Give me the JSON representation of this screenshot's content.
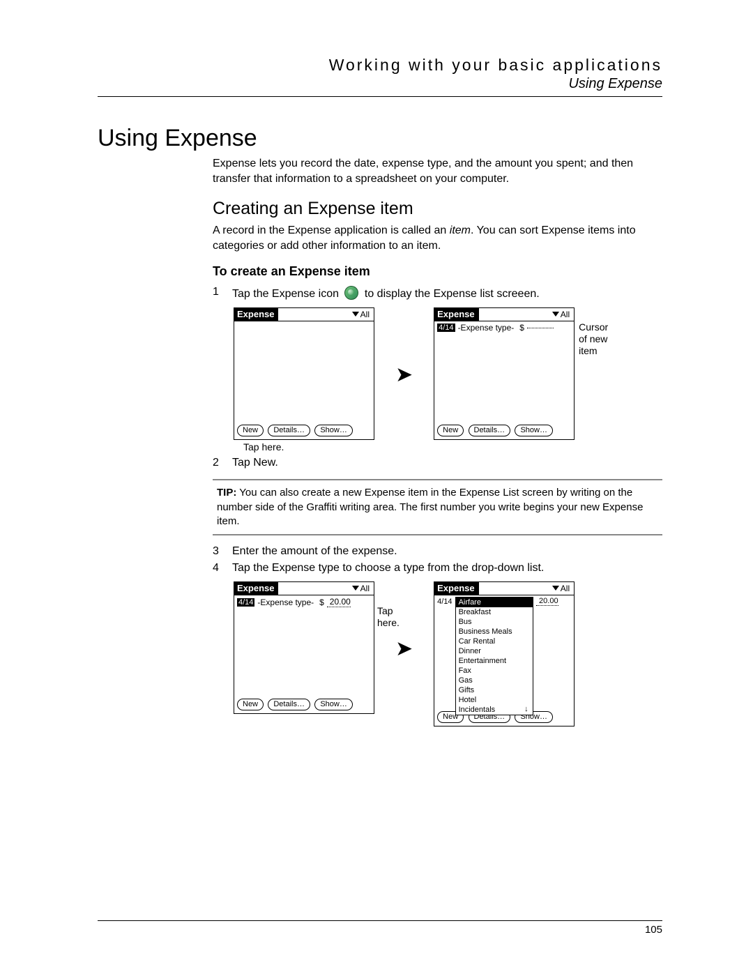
{
  "header": {
    "chapter": "Working with your basic applications",
    "section": "Using Expense"
  },
  "h1": "Using Expense",
  "intro": "Expense lets you record the date, expense type, and the amount you spent; and then transfer that information to a spreadsheet on your computer.",
  "h2": "Creating an Expense item",
  "p2a": "A record in the Expense application is called an ",
  "p2b_italic": "item",
  "p2c": ". You can sort Expense items into categories or add other information to an item.",
  "h3": "To create an Expense item",
  "steps": {
    "s1": {
      "n": "1",
      "a": "Tap the Expense icon ",
      "b": " to display the Expense list screeen."
    },
    "s2": {
      "n": "2",
      "t": "Tap New."
    },
    "s3": {
      "n": "3",
      "t": "Enter the amount of the expense."
    },
    "s4": {
      "n": "4",
      "t": "Tap the Expense type to choose a type from the drop-down list."
    }
  },
  "palm": {
    "title": "Expense",
    "filter": "All",
    "btn_new": "New",
    "btn_details": "Details…",
    "btn_show": "Show…",
    "date": "4/14",
    "type_placeholder": "-Expense type-",
    "currency": "$",
    "amount": "20.00"
  },
  "dropdown": [
    "Airfare",
    "Breakfast",
    "Bus",
    "Business Meals",
    "Car Rental",
    "Dinner",
    "Entertainment",
    "Fax",
    "Gas",
    "Gifts",
    "Hotel",
    "Incidentals"
  ],
  "captions": {
    "tap_here": "Tap here.",
    "cursor": "Cursor of new item",
    "tap_here2": "Tap here."
  },
  "tip": {
    "label": "TIP:",
    "text": "  You can also create a new Expense item in the Expense List screen by writing on the number side of the Graffiti writing area. The first number you write begins your new Expense item."
  },
  "page_number": "105"
}
